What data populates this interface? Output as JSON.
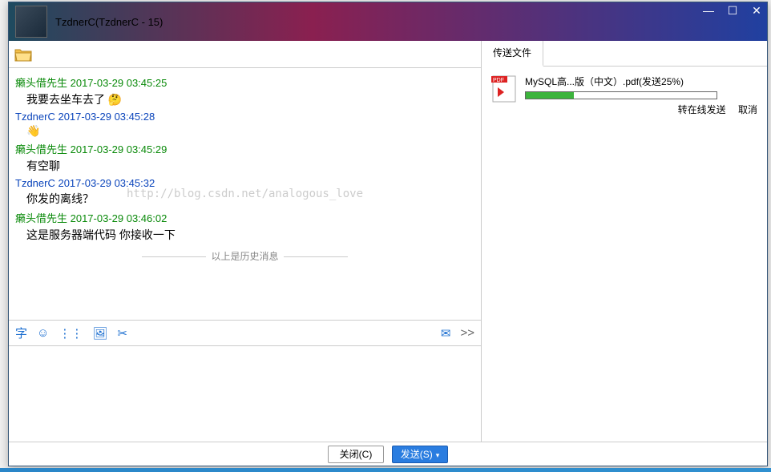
{
  "window": {
    "title": "TzdnerC(TzdnerC - 15)"
  },
  "chat": {
    "messages": [
      {
        "sender": "癞头借先生",
        "time": "2017-03-29 03:45:25",
        "self": false,
        "text": "我要去坐车去了 🤔"
      },
      {
        "sender": "TzdnerC",
        "time": "2017-03-29 03:45:28",
        "self": true,
        "text": "👋"
      },
      {
        "sender": "癞头借先生",
        "time": "2017-03-29 03:45:29",
        "self": false,
        "text": "有空聊"
      },
      {
        "sender": "TzdnerC",
        "time": "2017-03-29 03:45:32",
        "self": true,
        "text": "你发的离线？"
      },
      {
        "sender": "癞头借先生",
        "time": "2017-03-29 03:46:02",
        "self": false,
        "text": "这是服务器端代码 你接收一下"
      }
    ],
    "history_divider": "以上是历史消息",
    "watermark": "http://blog.csdn.net/analogous_love"
  },
  "editor_toolbar": {
    "font": "字",
    "emoji": "☺",
    "shake": "⋮⋮",
    "image": "🖼",
    "cut": "✂",
    "mail": "✉",
    "more": ">>"
  },
  "transfer": {
    "tab_label": "传送文件",
    "file": {
      "name": "MySQL高...版（中文）.pdf(发送25%)",
      "progress_percent": 25,
      "action_online": "转在线发送",
      "action_cancel": "取消"
    }
  },
  "footer": {
    "close": "关闭(C)",
    "send": "发送(S)"
  }
}
